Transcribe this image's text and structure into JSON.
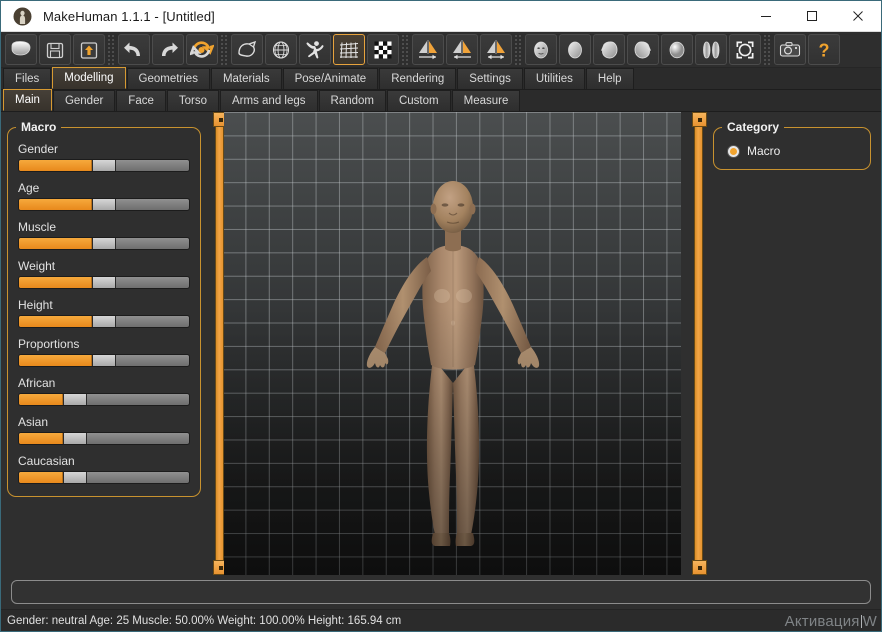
{
  "window": {
    "title": "MakeHuman 1.1.1 - [Untitled]",
    "app_icon": "makehuman-logo-icon",
    "minimize_label": "—",
    "maximize_label": "☐",
    "close_label": "✕"
  },
  "toolbar": {
    "groups": [
      {
        "buttons": [
          {
            "name": "new-icon",
            "label": "New"
          },
          {
            "name": "save-icon",
            "label": "Save"
          },
          {
            "name": "load-icon",
            "label": "Load"
          }
        ]
      },
      {
        "buttons": [
          {
            "name": "undo-icon",
            "label": "Undo"
          },
          {
            "name": "redo-icon",
            "label": "Redo"
          },
          {
            "name": "reset-icon",
            "label": "Reset mesh"
          }
        ]
      },
      {
        "buttons": [
          {
            "name": "smooth-icon",
            "label": "Smooth"
          },
          {
            "name": "wireframe-icon",
            "label": "Wireframe"
          },
          {
            "name": "pose-icon",
            "label": "Pose"
          },
          {
            "name": "grid-icon",
            "label": "Grid",
            "active": true
          },
          {
            "name": "subdivide-icon",
            "label": "Subdivide"
          }
        ]
      },
      {
        "buttons": [
          {
            "name": "symmetry-right-icon",
            "label": "Symmetry right"
          },
          {
            "name": "symmetry-left-icon",
            "label": "Symmetry left"
          },
          {
            "name": "symmetry-icon",
            "label": "Symmetry"
          }
        ]
      },
      {
        "buttons": [
          {
            "name": "view-front-icon",
            "label": "Front view"
          },
          {
            "name": "view-back-icon",
            "label": "Back view"
          },
          {
            "name": "view-left-icon",
            "label": "Left view"
          },
          {
            "name": "view-right-icon",
            "label": "Right view"
          },
          {
            "name": "view-top-icon",
            "label": "Top view"
          },
          {
            "name": "view-bottom-icon",
            "label": "Bottom view"
          },
          {
            "name": "reset-camera-icon",
            "label": "Reset camera"
          }
        ]
      },
      {
        "buttons": [
          {
            "name": "grab-screen-icon",
            "label": "Grab screen"
          },
          {
            "name": "help-icon",
            "label": "Help"
          }
        ]
      }
    ]
  },
  "main_tabs": {
    "active": "Modelling",
    "items": [
      "Files",
      "Modelling",
      "Geometries",
      "Materials",
      "Pose/Animate",
      "Rendering",
      "Settings",
      "Utilities",
      "Help"
    ]
  },
  "sub_tabs": {
    "active": "Main",
    "items": [
      "Main",
      "Gender",
      "Face",
      "Torso",
      "Arms and legs",
      "Random",
      "Custom",
      "Measure"
    ]
  },
  "left_panel": {
    "group_title": "Macro",
    "sliders": [
      {
        "label": "Gender",
        "value": 50
      },
      {
        "label": "Age",
        "value": 50
      },
      {
        "label": "Muscle",
        "value": 50
      },
      {
        "label": "Weight",
        "value": 50
      },
      {
        "label": "Height",
        "value": 50
      },
      {
        "label": "Proportions",
        "value": 50
      },
      {
        "label": "African",
        "value": 33
      },
      {
        "label": "Asian",
        "value": 33
      },
      {
        "label": "Caucasian",
        "value": 33
      }
    ]
  },
  "right_panel": {
    "group_title": "Category",
    "options": [
      {
        "label": "Macro",
        "selected": true
      }
    ]
  },
  "command_line": {
    "value": "",
    "placeholder": ""
  },
  "status": {
    "text": "Gender: neutral Age: 25 Muscle: 50.00% Weight: 100.00% Height: 165.94 cm",
    "fields": {
      "gender": "neutral",
      "age": "25",
      "muscle": "50.00%",
      "weight": "100.00%",
      "height": "165.94 cm"
    }
  },
  "watermark": {
    "text": "Активация",
    "trailing": "W"
  },
  "colors": {
    "accent_orange": "#f0a32e",
    "panel_bg": "#2f2f2f",
    "group_border": "#c8922f",
    "viewport_top": "#4b4e4f",
    "viewport_bottom": "#191919",
    "skin": "#a8876b"
  }
}
